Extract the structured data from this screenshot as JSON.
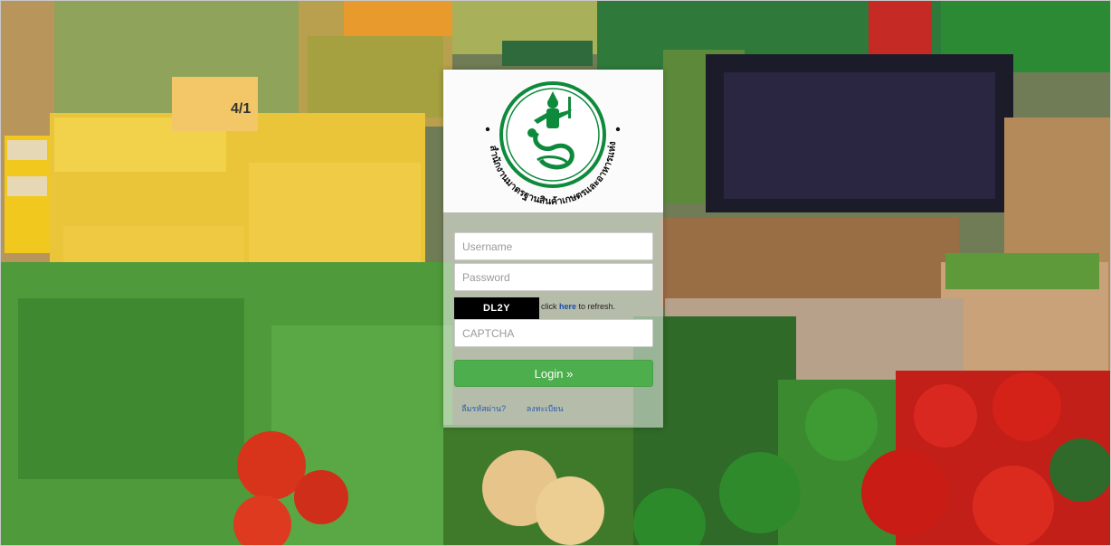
{
  "agency": {
    "name": "สำนักงานมาตรฐานสินค้าเกษตรและอาหารแห่งชาติ",
    "logo_icon": "naga-emblem-icon",
    "logo_color": "#0e8a3c"
  },
  "login": {
    "username_placeholder": "Username",
    "password_placeholder": "Password",
    "captcha_code": "DL2Y",
    "captcha_note_prefix": "click ",
    "captcha_note_link": "here",
    "captcha_note_suffix": " to refresh.",
    "captcha_placeholder": "CAPTCHA",
    "login_label": "Login »",
    "forgot_label": "ลืมรหัสผ่าน?",
    "register_label": "ลงทะเบียน",
    "button_color": "#4cae4c"
  },
  "background": {
    "lemon_sign": "4/1"
  }
}
